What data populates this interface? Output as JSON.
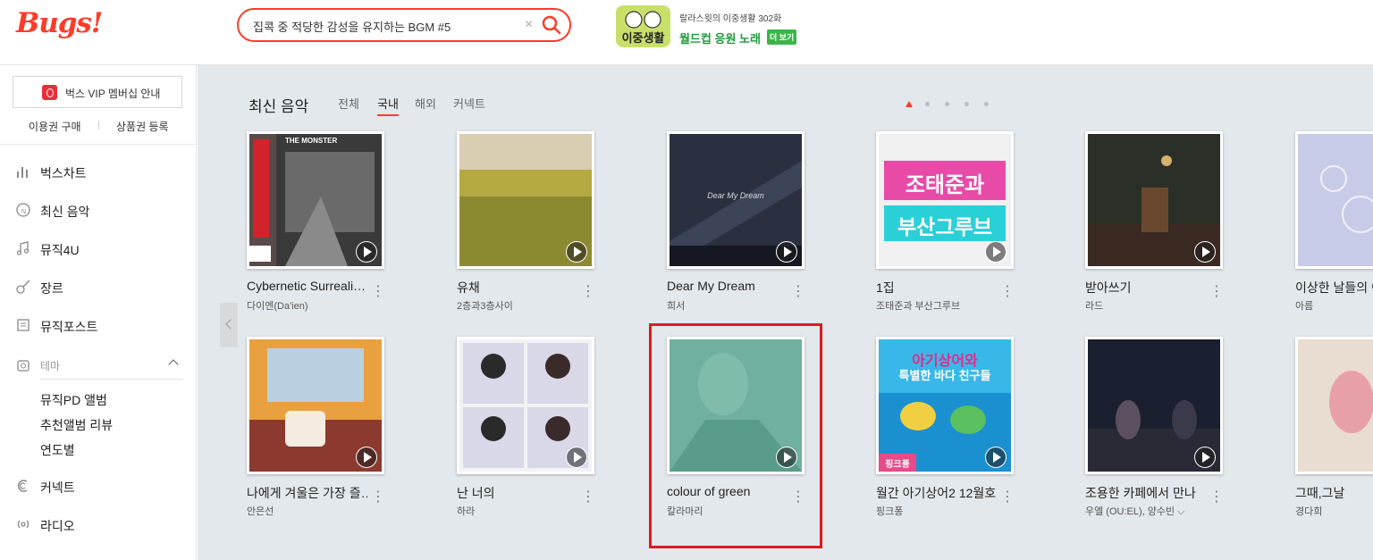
{
  "header": {
    "logo": "Bugs!",
    "search": {
      "value": "집콕 중 적당한 감성을 유지하는 BGM #5",
      "clear_icon": "×"
    },
    "promo": {
      "image_text": "이중생활",
      "small": "랄라스윗의 이중생활 302화",
      "big": "월드컵 응원 노래",
      "more": "더 보기"
    }
  },
  "sidebar": {
    "vip": "벅스 VIP 멤버십 안내",
    "links": [
      "이용권 구매",
      "상품권 등록"
    ],
    "nav": [
      {
        "label": "벅스차트",
        "icon": "chart-icon"
      },
      {
        "label": "최신 음악",
        "icon": "new-music-icon"
      },
      {
        "label": "뮤직4U",
        "icon": "music-note-icon"
      },
      {
        "label": "장르",
        "icon": "guitar-icon"
      },
      {
        "label": "뮤직포스트",
        "icon": "post-icon"
      }
    ],
    "theme": {
      "label": "테마",
      "items": [
        "뮤직PD 앨범",
        "추천앨범 리뷰",
        "연도별"
      ]
    },
    "nav2": [
      {
        "label": "커넥트",
        "icon": "connect-icon"
      },
      {
        "label": "라디오",
        "icon": "radio-icon"
      }
    ]
  },
  "main": {
    "title": "최신 음악",
    "filters": [
      "전체",
      "국내",
      "해외",
      "커넥트"
    ],
    "active_filter": "국내",
    "albums_row1": [
      {
        "title": "Cybernetic Surreali…",
        "artist": "다이엔(Da'ien)"
      },
      {
        "title": "유채",
        "artist": "2층과3층사이"
      },
      {
        "title": "Dear My Dream",
        "artist": "희서"
      },
      {
        "title": "1집",
        "artist": "조태준과 부산그루브"
      },
      {
        "title": "받아쓰기",
        "artist": "라드"
      },
      {
        "title": "이상한 날들의 이",
        "artist": "아름"
      }
    ],
    "albums_row2": [
      {
        "title": "나에게 겨울은 가장 즐…",
        "artist": "안은선"
      },
      {
        "title": "난 너의",
        "artist": "하라"
      },
      {
        "title": "colour of green",
        "artist": "칼라마리"
      },
      {
        "title": "월간 아기상어2 12월호",
        "artist": "핑크퐁"
      },
      {
        "title": "조용한 카페에서 만나",
        "artist": "우엘 (OU:EL), 양수빈 ⌵"
      },
      {
        "title": "그때,그날",
        "artist": "경다희"
      }
    ],
    "cover_texts": {
      "dear_my_dream": "Dear My Dream",
      "jotaejun_1": "조태준과",
      "jotaejun_2": "부산그루브",
      "pinkfong_1": "아기상어와",
      "pinkfong_2": "특별한 바다 친구들",
      "pinkfong_brand": "핑크퐁",
      "monster": "THE MONSTER"
    }
  },
  "colors": {
    "accent": "#ff3b28",
    "main_bg": "#e3e8ec",
    "highlight": "#e0191f"
  }
}
